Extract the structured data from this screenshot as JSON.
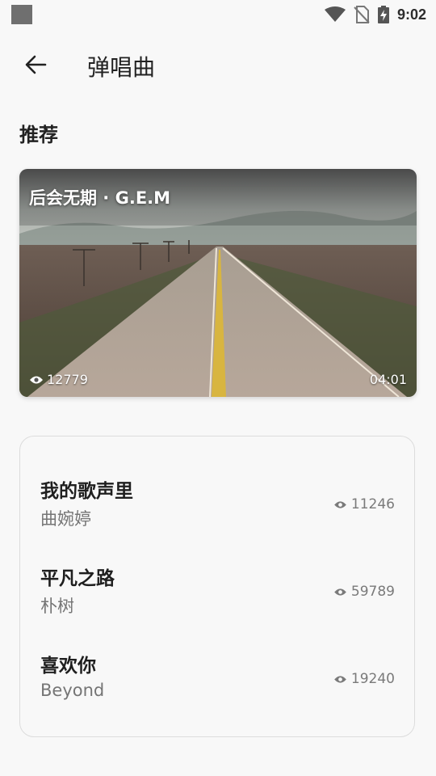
{
  "status_bar": {
    "time": "9:02",
    "icons": [
      "notification-icon",
      "wifi-icon",
      "no-sim-icon",
      "battery-charging-icon"
    ]
  },
  "app_bar": {
    "back_icon": "arrow-left-icon",
    "title": "弹唱曲"
  },
  "section": {
    "title": "推荐"
  },
  "featured": {
    "title": "后会无期 · G.E.M",
    "views": "12779",
    "duration": "04:01",
    "image": "long straight desert highway"
  },
  "songs": [
    {
      "title": "我的歌声里",
      "artist": "曲婉婷",
      "views": "11246"
    },
    {
      "title": "平凡之路",
      "artist": "朴树",
      "views": "59789"
    },
    {
      "title": "喜欢你",
      "artist": "Beyond",
      "views": "19240"
    }
  ],
  "colors": {
    "background": "#f8f8f8",
    "card_border": "#dcdcdc",
    "text_primary": "#1f1f1f",
    "text_secondary": "#757575"
  }
}
